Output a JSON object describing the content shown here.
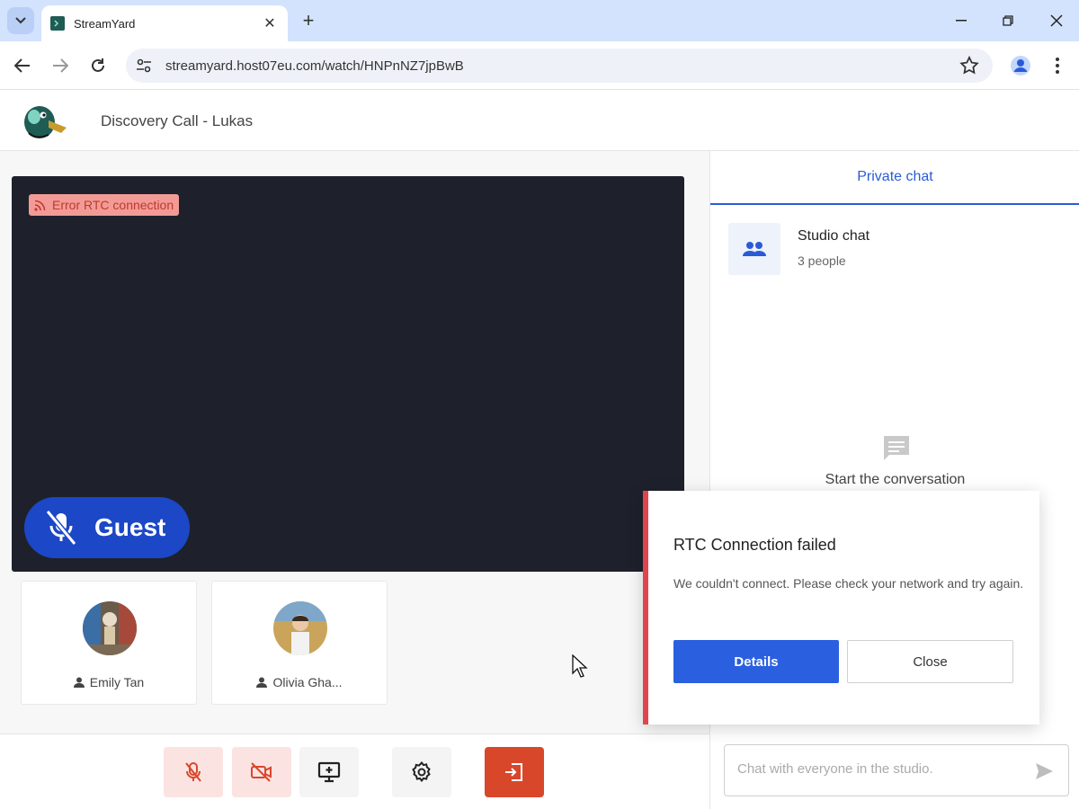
{
  "browser": {
    "tab_title": "StreamYard",
    "url": "streamyard.host07eu.com/watch/HNPnNZ7jpBwB"
  },
  "header": {
    "call_title": "Discovery Call - Lukas"
  },
  "stage": {
    "error_badge": "Error RTC connection",
    "guest_label": "Guest"
  },
  "participants": [
    {
      "name": "Emily Tan"
    },
    {
      "name": "Olivia Gha..."
    }
  ],
  "toolbar": {
    "mic_state": "muted",
    "camera_state": "off"
  },
  "sidebar": {
    "tab_label": "Private chat",
    "chat_name": "Studio chat",
    "chat_count": "3 people",
    "empty_text": "Start the conversation",
    "input_placeholder": "Chat with everyone in the studio."
  },
  "modal": {
    "title": "RTC Connection failed",
    "message": "We couldn't connect. Please check your network and try again.",
    "details_label": "Details",
    "close_label": "Close"
  },
  "colors": {
    "accent": "#2a5bd7",
    "danger": "#e0454f",
    "leave_button": "#d9472b",
    "video_bg": "#1e212b"
  }
}
